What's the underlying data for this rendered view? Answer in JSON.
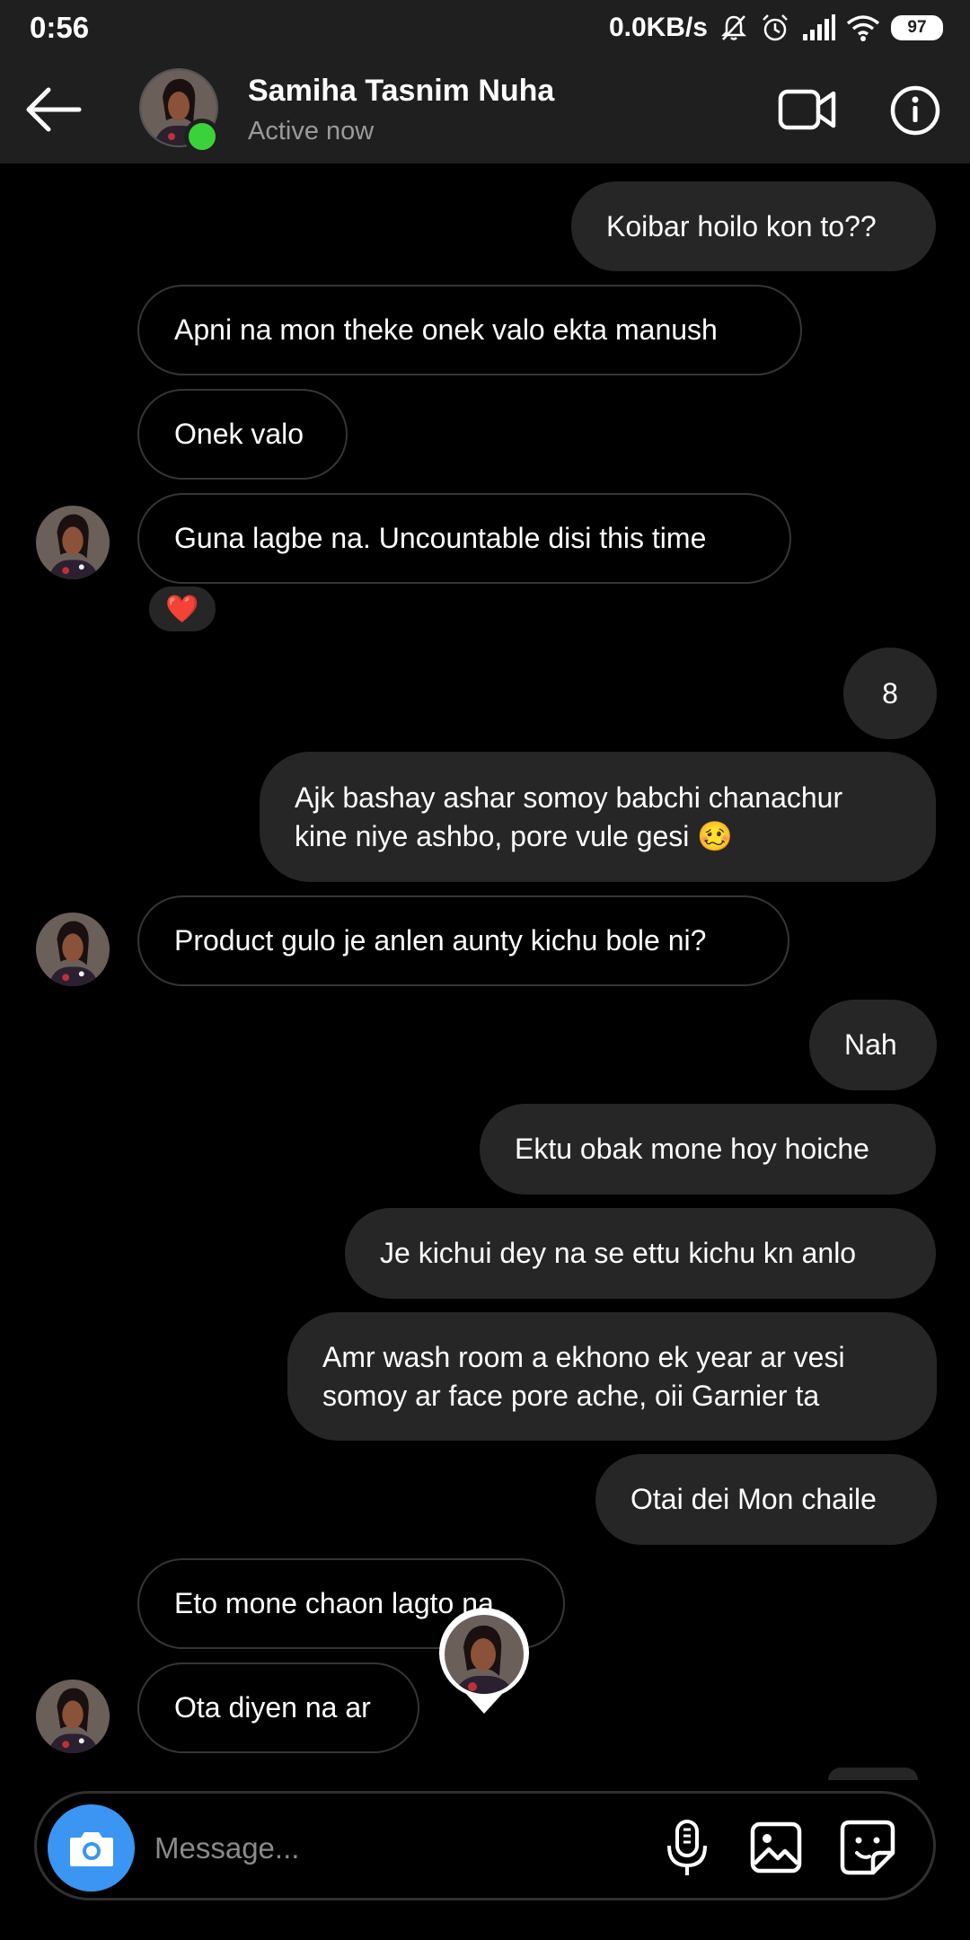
{
  "status_bar": {
    "time": "0:56",
    "network_speed": "0.0KB/s",
    "battery": "97",
    "icons": [
      "mute-icon",
      "alarm-icon",
      "signal-icon",
      "wifi-icon",
      "battery-icon"
    ]
  },
  "header": {
    "contact_name": "Samiha Tasnim Nuha",
    "contact_status": "Active now",
    "online_color": "#3bd13b",
    "icons": [
      "back-arrow-icon",
      "video-call-icon",
      "info-icon"
    ]
  },
  "messages": [
    {
      "side": "out",
      "text": "Koibar hoilo kon to??"
    },
    {
      "side": "in",
      "text": "Apni na mon theke onek valo ekta manush"
    },
    {
      "side": "in",
      "text": "Onek valo"
    },
    {
      "side": "in",
      "text": "Guna lagbe na. Uncountable disi this time",
      "reaction": "❤️"
    },
    {
      "side": "out",
      "text": "8"
    },
    {
      "side": "out",
      "text": "Ajk bashay ashar somoy babchi chanachur\nkine niye ashbo, pore vule gesi 🥴"
    },
    {
      "side": "in",
      "text": "Product gulo je anlen aunty kichu bole ni?"
    },
    {
      "side": "out",
      "text": "Nah"
    },
    {
      "side": "out",
      "text": "Ektu obak mone hoy hoiche"
    },
    {
      "side": "out",
      "text": "Je kichui dey na se ettu kichu kn anlo"
    },
    {
      "side": "out",
      "text": "Amr wash room a ekhono ek year ar vesi\nsomoy ar face pore ache, oii Garnier ta"
    },
    {
      "side": "out",
      "text": "Otai dei Mon chaile"
    },
    {
      "side": "in",
      "text": "Eto mone chaon lagto na."
    },
    {
      "side": "in",
      "text": "Ota diyen na ar"
    }
  ],
  "composer": {
    "placeholder": "Message...",
    "camera_color": "#3a96f2",
    "icons": [
      "camera-icon",
      "microphone-icon",
      "gallery-icon",
      "sticker-icon"
    ]
  }
}
